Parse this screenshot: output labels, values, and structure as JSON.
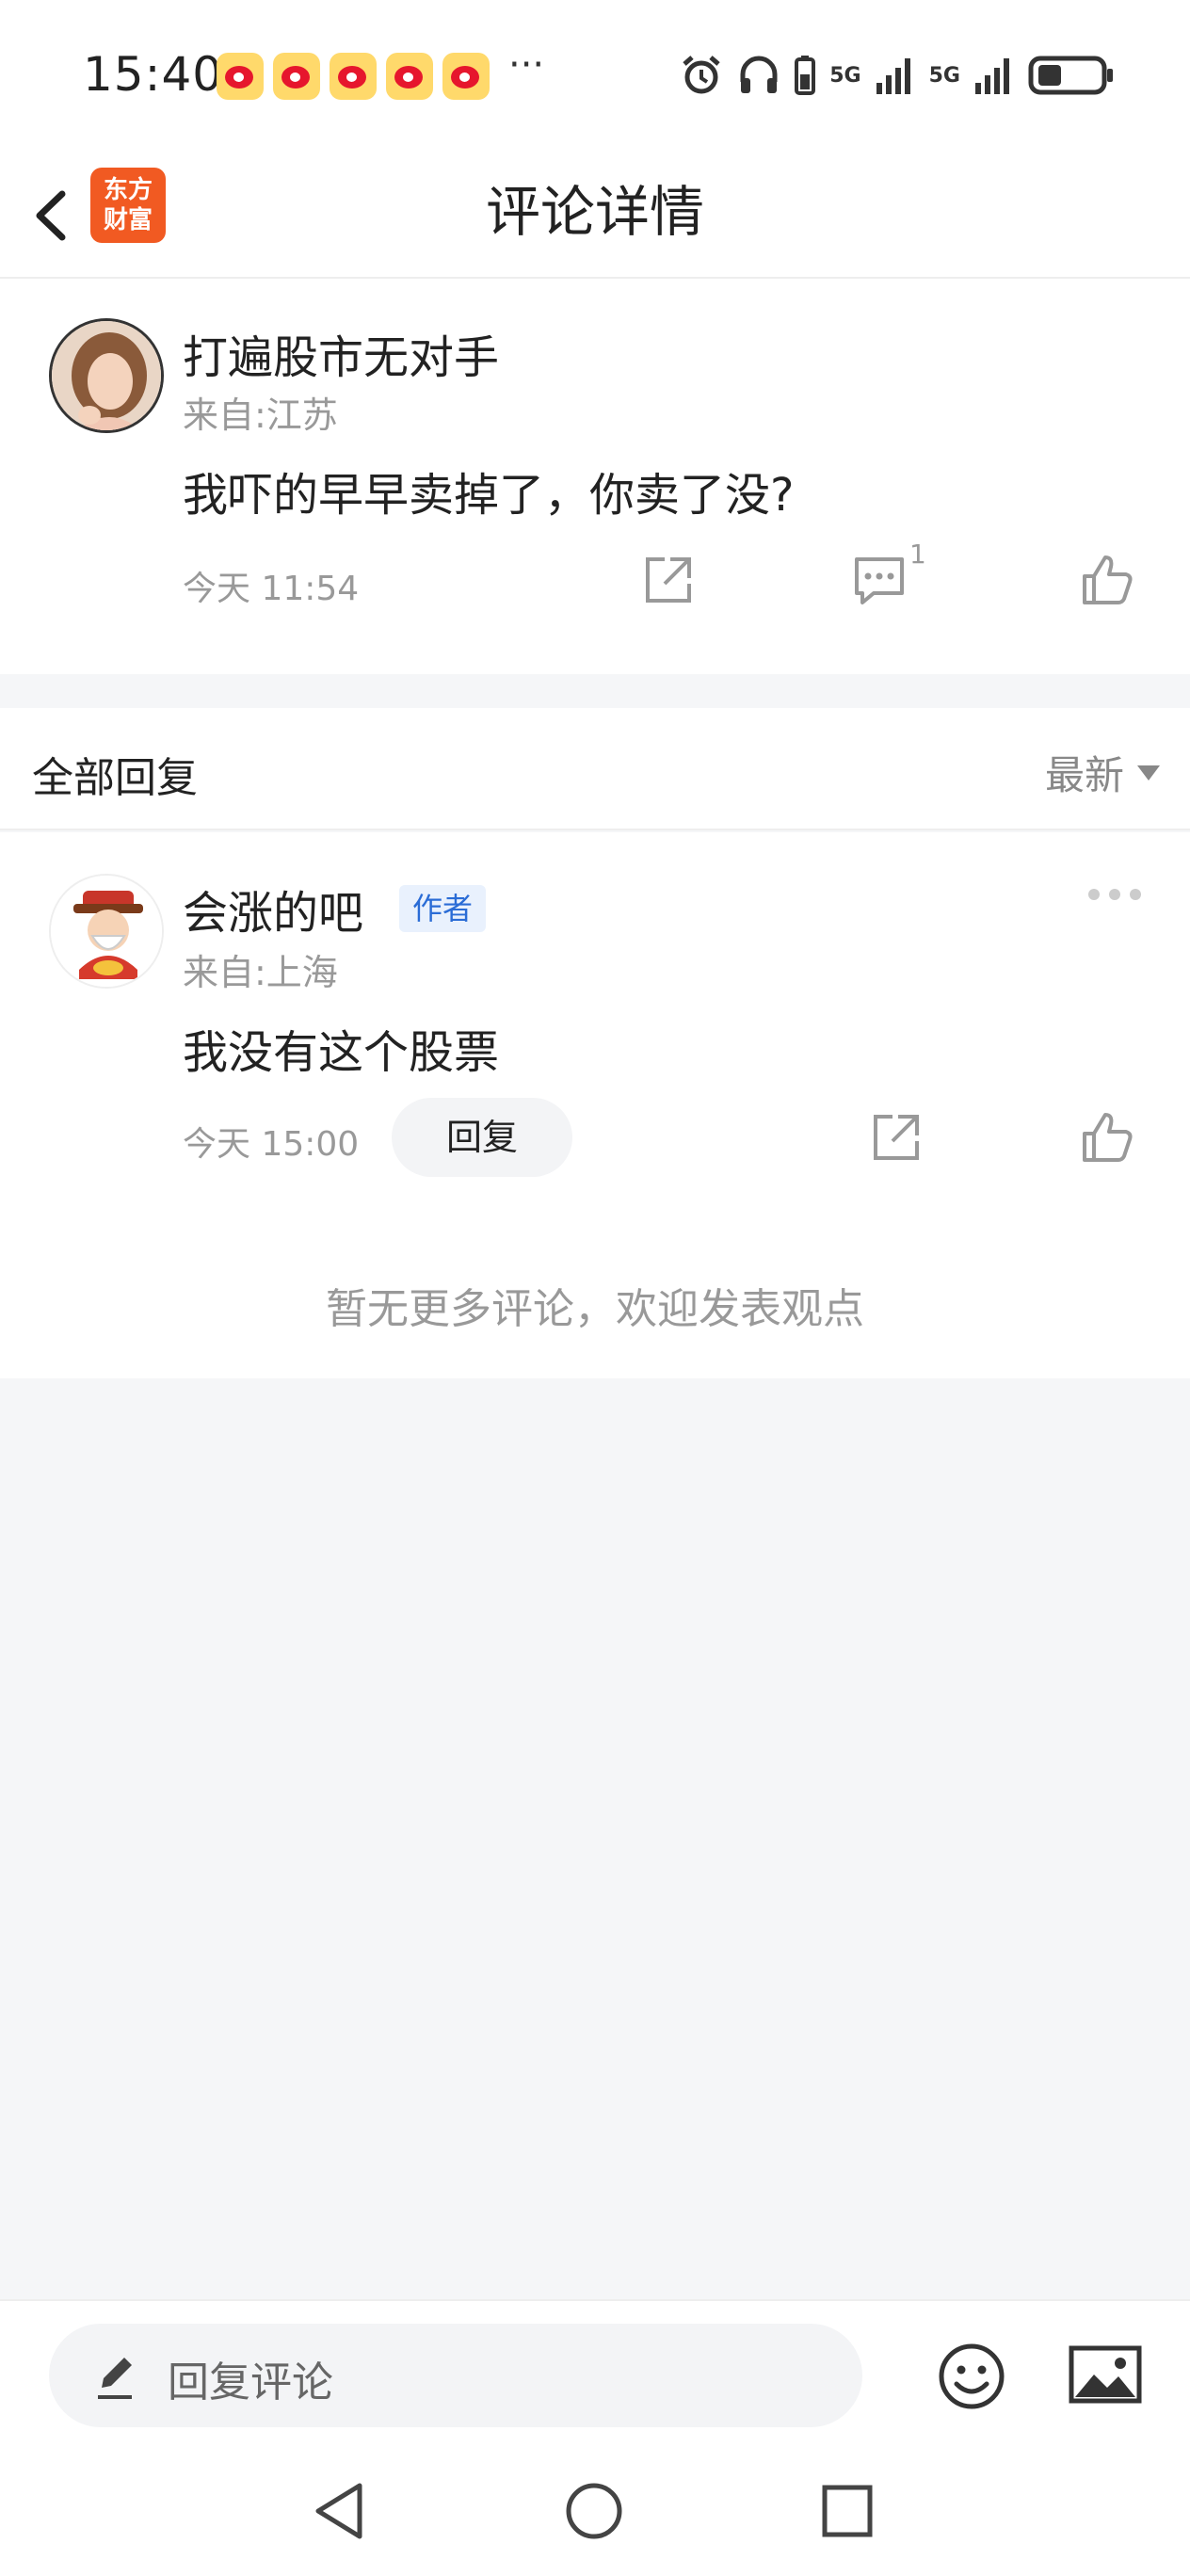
{
  "status_bar": {
    "time": "15:40",
    "overflow": "···",
    "signal_label_1": "5G",
    "signal_label_2": "5G",
    "icons": [
      "weibo-icon",
      "weibo-icon",
      "weibo-icon",
      "weibo-icon",
      "weibo-icon",
      "alarm-icon",
      "headphones-icon",
      "battery-small-icon",
      "signal-icon",
      "signal-icon",
      "battery-icon"
    ]
  },
  "nav": {
    "title": "评论详情",
    "logo_line1": "东方",
    "logo_line2": "财富",
    "logo_color": "#f15a22"
  },
  "main_comment": {
    "username": "打遍股市无对手",
    "location": "来自:江苏",
    "content": "我吓的早早卖掉了，你卖了没?",
    "time": "今天 11:54",
    "comment_count": "1"
  },
  "replies": {
    "header": "全部回复",
    "sort_label": "最新",
    "items": [
      {
        "username": "会涨的吧",
        "badge": "作者",
        "location": "来自:上海",
        "content": "我没有这个股票",
        "time": "今天 15:00",
        "reply_label": "回复"
      }
    ],
    "no_more": "暂无更多评论，欢迎发表观点"
  },
  "bottom": {
    "input_placeholder": "回复评论"
  },
  "colors": {
    "badge_text": "#2a6cd6",
    "badge_bg": "#e9f1fd",
    "page_bg": "#f5f6f8"
  }
}
